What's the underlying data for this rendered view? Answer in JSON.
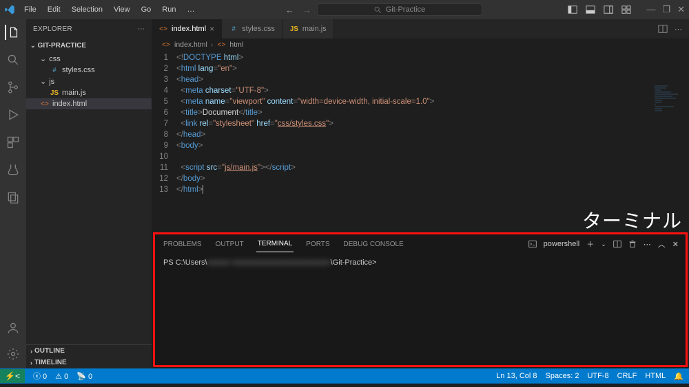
{
  "menu": [
    "File",
    "Edit",
    "Selection",
    "View",
    "Go",
    "Run",
    "…"
  ],
  "search": {
    "placeholder": "Git-Practice"
  },
  "explorer": {
    "title": "EXPLORER",
    "root": "GIT-PRACTICE",
    "folders": {
      "css": {
        "name": "css",
        "files": [
          {
            "name": "styles.css",
            "icon": "css"
          }
        ]
      },
      "js": {
        "name": "js",
        "files": [
          {
            "name": "main.js",
            "icon": "js"
          }
        ]
      }
    },
    "rootFiles": [
      {
        "name": "index.html",
        "icon": "html"
      }
    ],
    "outline": "OUTLINE",
    "timeline": "TIMELINE"
  },
  "tabs": [
    {
      "name": "index.html",
      "icon": "html",
      "active": true
    },
    {
      "name": "styles.css",
      "icon": "css",
      "active": false
    },
    {
      "name": "main.js",
      "icon": "js",
      "active": false
    }
  ],
  "breadcrumb": [
    "index.html",
    "html"
  ],
  "code": {
    "lines": [
      1,
      2,
      3,
      4,
      5,
      6,
      7,
      8,
      9,
      10,
      11,
      12,
      13
    ]
  },
  "terminal": {
    "tabs": [
      "PROBLEMS",
      "OUTPUT",
      "TERMINAL",
      "PORTS",
      "DEBUG CONSOLE"
    ],
    "activeTab": "TERMINAL",
    "label": "powershell",
    "promptPrefix": "PS C:\\Users\\",
    "promptHidden": "xxxxxx xxxxxxxxxxxxxxxxxxxxxxxxxx",
    "promptSuffix": "\\Git-Practice>"
  },
  "status": {
    "errors": "0",
    "warnings": "0",
    "radio": "0",
    "ln": "Ln 13, Col 8",
    "spaces": "Spaces: 2",
    "encoding": "UTF-8",
    "eol": "CRLF",
    "lang": "HTML"
  },
  "annotation": "ターミナル"
}
